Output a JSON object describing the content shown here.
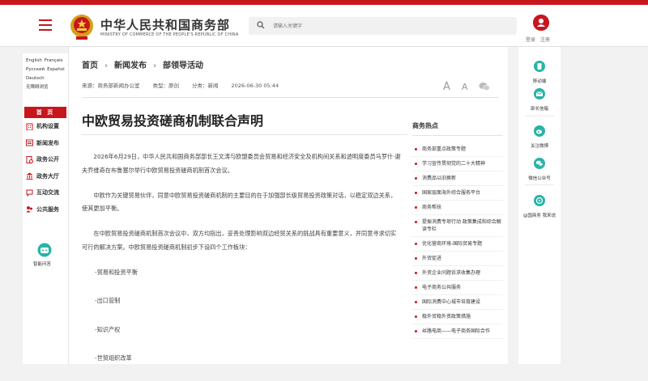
{
  "header": {
    "title_cn": "中华人民共和国商务部",
    "title_en": "MINISTRY OF COMMERCE OF THE PEOPLE'S REPUBLIC OF CHINA",
    "search_placeholder": "请输入关键字",
    "user_login": "登录",
    "user_register": "注册",
    "accent_color": "#c8161d"
  },
  "leftnav": {
    "langs": [
      [
        "English",
        "Français"
      ],
      [
        "Русский",
        "Español"
      ],
      [
        "Deutsch"
      ],
      [
        "无障碍浏览"
      ]
    ],
    "home": "首 页",
    "items": [
      {
        "label": "机构设置",
        "icon": "building-icon"
      },
      {
        "label": "新闻发布",
        "icon": "news-icon"
      },
      {
        "label": "政务公开",
        "icon": "open-gov-icon"
      },
      {
        "label": "政务大厅",
        "icon": "hall-icon"
      },
      {
        "label": "互动交流",
        "icon": "chat-icon"
      },
      {
        "label": "公共服务",
        "icon": "service-icon"
      }
    ],
    "smart_qa": "智能问答"
  },
  "breadcrumb": {
    "home": "首页",
    "section": "新闻发布",
    "sub": "部领导活动"
  },
  "meta": {
    "source": "来源：商务部新闻办公室",
    "type": "类型：原创",
    "category": "分类：新闻",
    "date": "2026-06-30 05:44"
  },
  "tools": {
    "font_large": "A",
    "font_small": "A",
    "share_icon": "wechat-icon"
  },
  "article": {
    "title": "中欧贸易投资磋商机制联合声明",
    "paragraphs": [
      "2026年6月29日，中华人民共和国商务部部长王文涛与欧盟委员会贸易和经济安全及机构间关系和透明度委员马罗什·谢夫乔维奇在布鲁塞尔举行中欧贸易投资磋商机制首次会议。",
      "中欧作为关键贸易伙伴，同意中欧贸易投资磋商机制的主要目的在于加强部长级贸易投资政策对话，以稳定双边关系，使其更加平衡。",
      "在中欧贸易投资磋商机制首次会议中，双方均指出，妥善处理影响双边经贸关系的挑战具有重要意义，并同意寻求切实可行的解决方案。中欧贸易投资磋商机制初步下设四个工作板块："
    ],
    "items": [
      "-贸易和投资平衡",
      "-出口管制",
      "-知识产权",
      "-世贸组织改革"
    ]
  },
  "hot": {
    "title": "商务热点",
    "items": [
      "商务部重点政策专题",
      "学习宣传贯彻党的二十大精神",
      "消费品以旧换新",
      "国家层面海外综合服务平台",
      "商务帮扶",
      "提振消费专项行动 政策集成和综合解读专栏",
      "优化营商环境-国际贸易专题",
      "外贸促进",
      "外资企业问题诉求收集办理",
      "电子商务公共服务",
      "国际消费中心城市培育建设",
      "稳外贸稳外资政策措施",
      "丝路电商——电子商务国际合作"
    ]
  },
  "rightnav": {
    "items": [
      {
        "label": "移动端",
        "icon": "mobile-icon"
      },
      {
        "label": "部长信箱",
        "icon": "mailbox-icon"
      },
      {
        "label": "关注微博",
        "icon": "weibo-icon"
      },
      {
        "label": "微信公众号",
        "icon": "wechat-account-icon"
      },
      {
        "label": "@国商务 我来说",
        "icon": "feedback-icon"
      }
    ]
  }
}
